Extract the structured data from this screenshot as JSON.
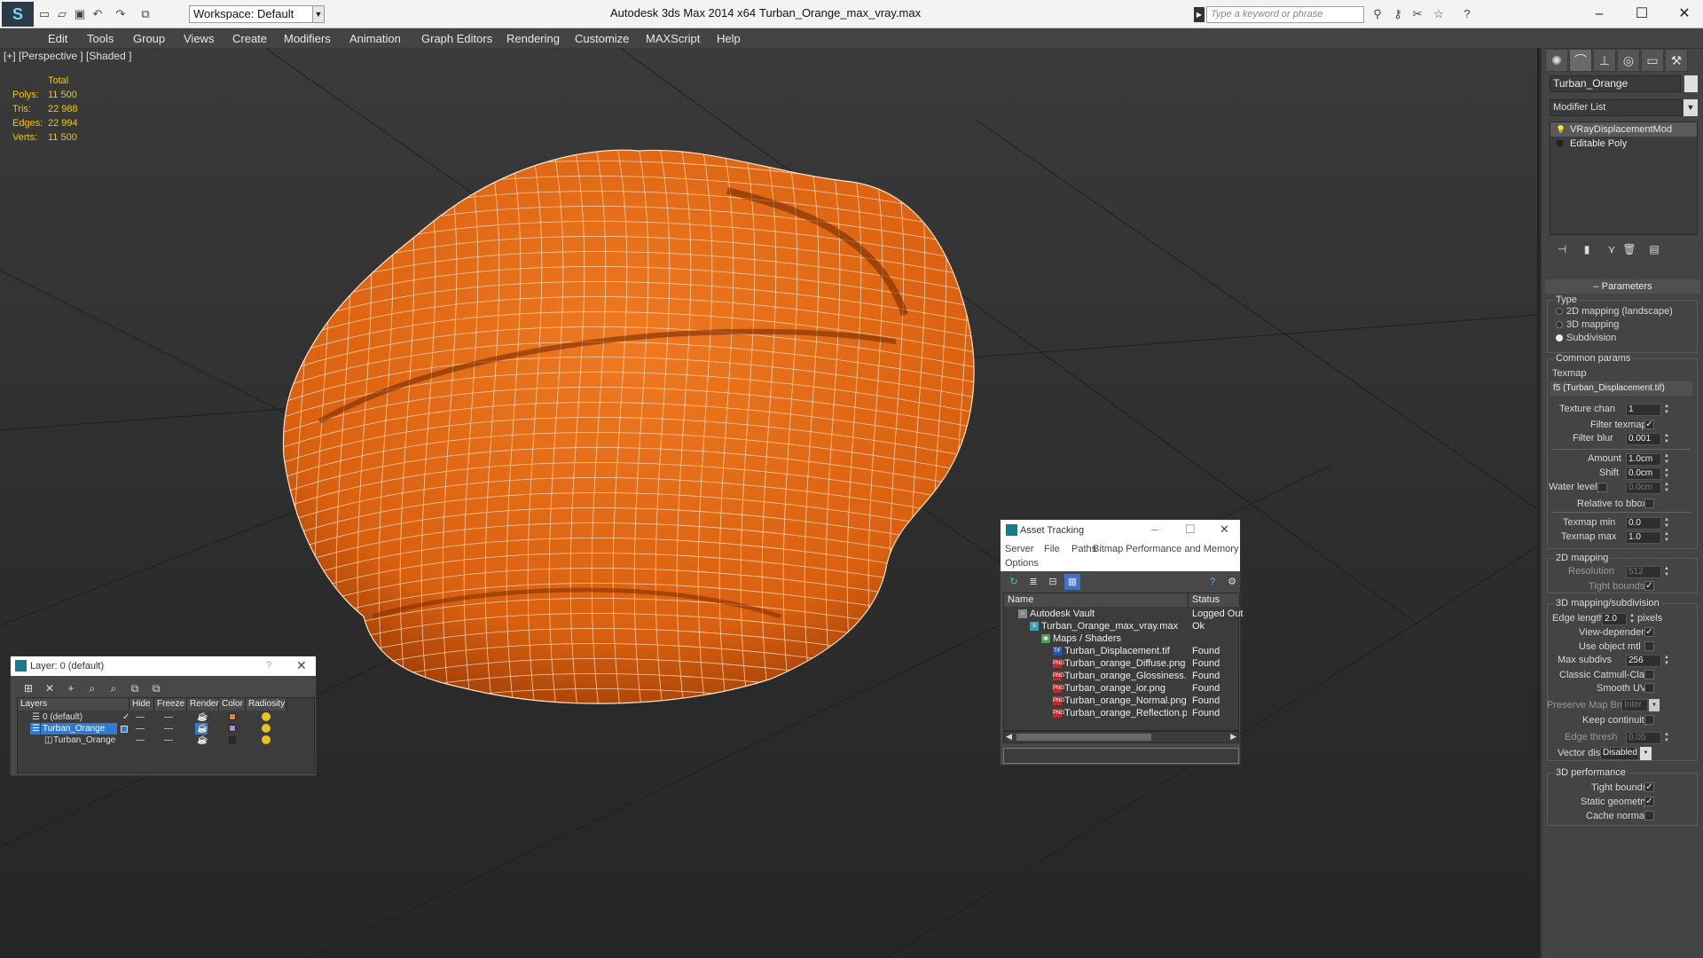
{
  "window": {
    "app_title": "Autodesk 3ds Max  2014 x64",
    "file_title": "Turban_Orange_max_vray.max",
    "workspace_label": "Workspace: Default",
    "search_placeholder": "Type a keyword or phrase"
  },
  "menu": [
    "Edit",
    "Tools",
    "Group",
    "Views",
    "Create",
    "Modifiers",
    "Animation",
    "Graph Editors",
    "Rendering",
    "Customize",
    "MAXScript",
    "Help"
  ],
  "viewport": {
    "label": "[+] [Perspective ] [Shaded ]",
    "stats": {
      "header": "Total",
      "polys_label": "Polys:",
      "polys": "11 500",
      "tris_label": "Tris:",
      "tris": "22 988",
      "edges_label": "Edges:",
      "edges": "22 994",
      "verts_label": "Verts:",
      "verts": "11 500"
    },
    "model_color": "#e56a14",
    "wire_color": "#ffffff"
  },
  "command_panel": {
    "object_name": "Turban_Orange",
    "modifier_list": "Modifier List",
    "stack": [
      "VRayDisplacementMod",
      "Editable Poly"
    ],
    "parameters_title": "Parameters",
    "type_title": "Type",
    "type_options": [
      "2D mapping (landscape)",
      "3D mapping",
      "Subdivision"
    ],
    "type_selected": "Subdivision",
    "common_title": "Common params",
    "texmap_label": "Texmap",
    "texmap_value": "f5 (Turban_Displacement.tif)",
    "texture_chan_label": "Texture chan",
    "texture_chan": "1",
    "filter_texmap_label": "Filter texmap",
    "filter_blur_label": "Filter blur",
    "filter_blur": "0.001",
    "amount_label": "Amount",
    "amount": "1.0cm",
    "shift_label": "Shift",
    "shift": "0.0cm",
    "water_level_label": "Water level",
    "water_level": "0.0cm",
    "relative_bbox_label": "Relative to bbox",
    "texmap_min_label": "Texmap min",
    "texmap_min": "0.0",
    "texmap_max_label": "Texmap max",
    "texmap_max": "1.0",
    "mapping2d_title": "2D mapping",
    "resolution_label": "Resolution",
    "resolution": "512",
    "tight_bounds_label": "Tight bounds",
    "mapping3d_title": "3D mapping/subdivision",
    "edge_length_label": "Edge length",
    "edge_length": "2.0",
    "pixels_label": "pixels",
    "view_dependent_label": "View-dependent",
    "use_object_mtl_label": "Use object mtl",
    "max_subdivs_label": "Max subdivs",
    "max_subdivs": "256",
    "catmull_label": "Classic Catmull-Clark",
    "smooth_uvs_label": "Smooth UVs",
    "preserve_map_label": "Preserve Map Bnd",
    "preserve_map_value": "Inter",
    "keep_continuity_label": "Keep continuity",
    "edge_thresh_label": "Edge thresh",
    "edge_thresh": "0.05",
    "vector_displ_label": "Vector displ",
    "vector_displ": "Disabled",
    "perf_title": "3D performance",
    "perf_tight_bounds_label": "Tight bounds",
    "static_geometry_label": "Static geometry",
    "cache_normals_label": "Cache normals"
  },
  "layer_dialog": {
    "title": "Layer: 0 (default)",
    "help": "?",
    "columns": [
      "Layers",
      "Hide",
      "Freeze",
      "Render",
      "Color",
      "Radiosity"
    ],
    "rows": [
      {
        "name": "0 (default)",
        "color": "#e0813a"
      },
      {
        "name": "Turban_Orange",
        "color": "#b08ad8"
      },
      {
        "name": "Turban_Orange",
        "color": "#2a2a2a"
      }
    ]
  },
  "asset_dialog": {
    "title": "Asset Tracking",
    "menu": [
      "Server",
      "File",
      "Paths",
      "Bitmap Performance and Memory",
      "Options"
    ],
    "columns": [
      "Name",
      "Status"
    ],
    "rows": [
      {
        "name": "Autodesk Vault",
        "status": "Logged Out",
        "indent": 0,
        "icon": "vault-icon"
      },
      {
        "name": "Turban_Orange_max_vray.max",
        "status": "Ok",
        "indent": 1,
        "icon": "max-file-icon"
      },
      {
        "name": "Maps / Shaders",
        "status": "",
        "indent": 2,
        "icon": "maps-icon"
      },
      {
        "name": "Turban_Displacement.tif",
        "status": "Found",
        "indent": 3,
        "icon": "tif-icon"
      },
      {
        "name": "Turban_orange_Diffuse.png",
        "status": "Found",
        "indent": 3,
        "icon": "png-icon"
      },
      {
        "name": "Turban_orange_Glossiness.png",
        "status": "Found",
        "indent": 3,
        "icon": "png-icon"
      },
      {
        "name": "Turban_orange_ior.png",
        "status": "Found",
        "indent": 3,
        "icon": "png-icon"
      },
      {
        "name": "Turban_orange_Normal.png",
        "status": "Found",
        "indent": 3,
        "icon": "png-icon"
      },
      {
        "name": "Turban_orange_Reflection.png",
        "status": "Found",
        "indent": 3,
        "icon": "png-icon"
      }
    ]
  }
}
